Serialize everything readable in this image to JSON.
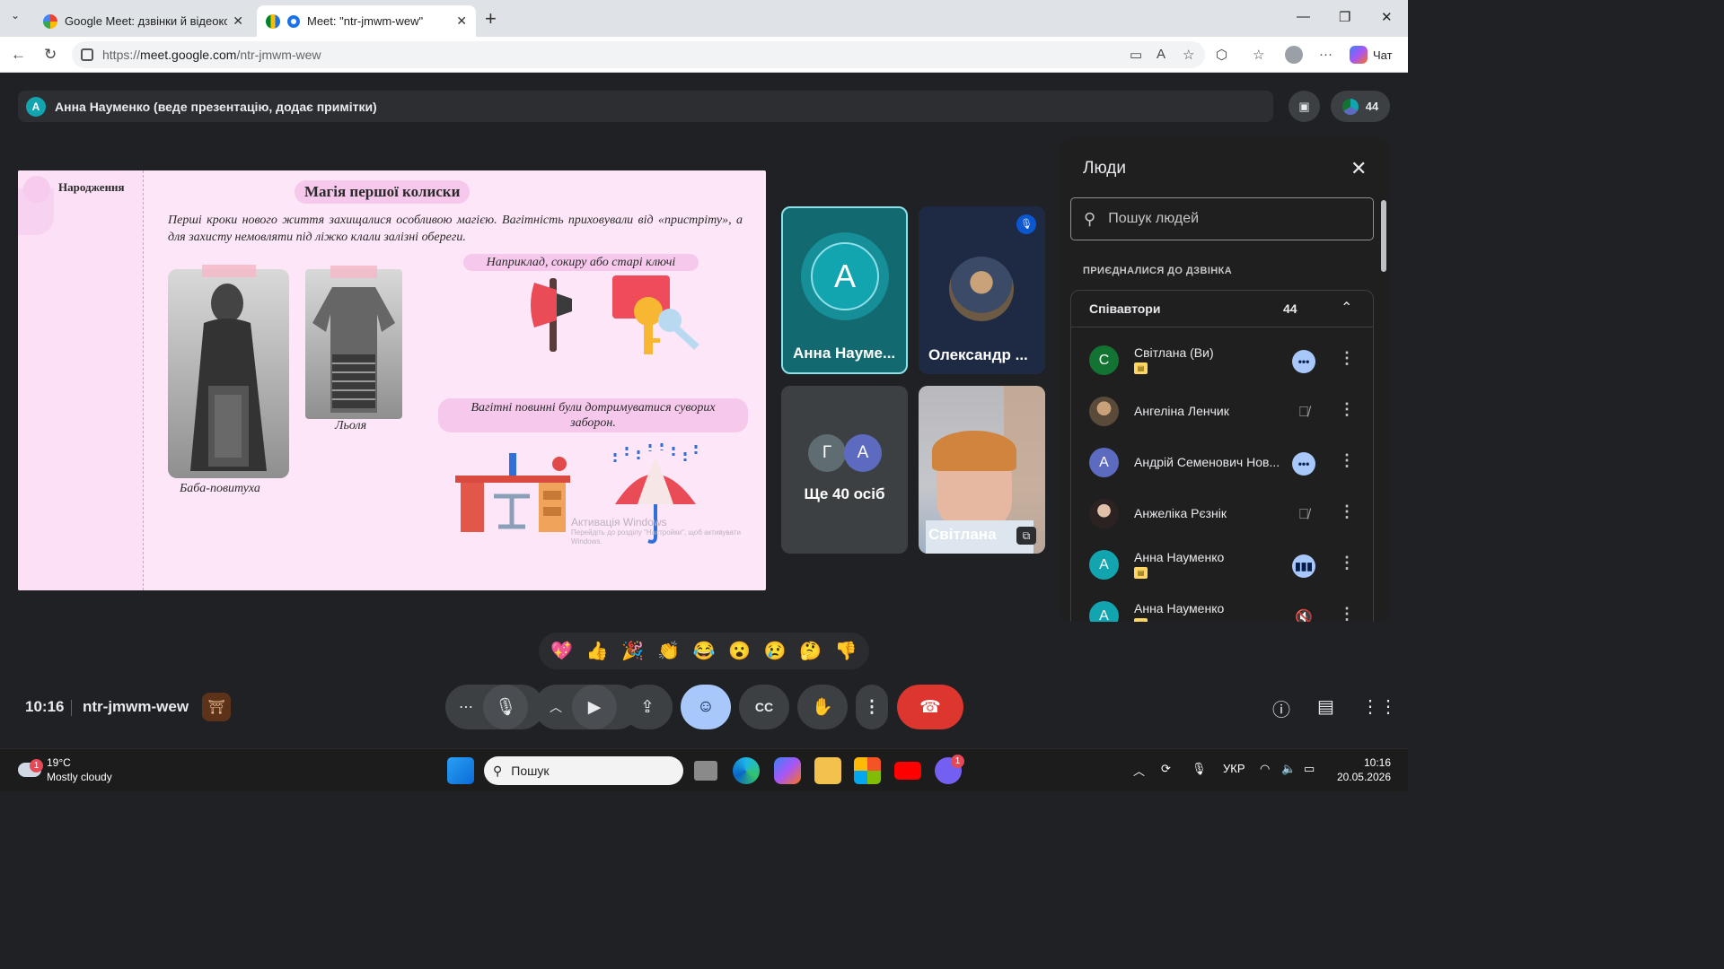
{
  "browser": {
    "tabs": [
      {
        "title": "Google Meet: дзвінки й відеоконференції",
        "active": false
      },
      {
        "title": "Meet: \"ntr-jmwm-wew\"",
        "active": true
      }
    ],
    "url_scheme": "https://",
    "url_host": "meet.google.com",
    "url_path": "/ntr-jmwm-wew",
    "chat_label": "Чат"
  },
  "meet": {
    "presenter_initial": "A",
    "presenter_text": "Анна Науменко (веде презентацію, додає примітки)",
    "participant_count": "44",
    "slide": {
      "section": "Народження",
      "title": "Магія першої колиски",
      "paragraph": "Перші кроки нового життя захищалися особливою магією. Вагітність приховували від «пристріту», а для захисту немовляти під ліжко клали залізні обереги.",
      "caption_left": "Баба-повитуха",
      "caption_right": "Льоля",
      "example_pill": "Наприклад, сокиру або старі ключі",
      "rules_pill": "Вагітні повинні були дотримуватися суворих заборон.",
      "watermark_title": "Активація Windows",
      "watermark_sub": "Перейдіть до розділу \"Настройки\", щоб активувати Windows."
    },
    "tiles": [
      {
        "name": "Анна Науме...",
        "initial": "A"
      },
      {
        "name": "Олександр ..."
      },
      {
        "name": "Ще 40 осіб",
        "initials": [
          "Г",
          "A"
        ]
      },
      {
        "name": "Світлана"
      }
    ],
    "people_panel": {
      "title": "Люди",
      "search_placeholder": "Пошук людей",
      "section_label": "ПРИЄДНАЛИСЯ ДО ДЗВІНКА",
      "group_name": "Співавтори",
      "group_count": "44",
      "participants": [
        {
          "name": "Світлана (Ви)",
          "initial": "С",
          "color": "#137333",
          "badge": true,
          "status": "dots"
        },
        {
          "name": "Ангеліна Ленчик",
          "initial": "",
          "color": "#6b5a3a",
          "badge": false,
          "status": "muted"
        },
        {
          "name": "Андрій Семенович Нов...",
          "initial": "A",
          "color": "#5c6bc0",
          "badge": false,
          "status": "dots"
        },
        {
          "name": "Анжеліка Рєзнік",
          "initial": "",
          "color": "#4a3b3b",
          "badge": false,
          "status": "muted"
        },
        {
          "name": "Анна Науменко",
          "initial": "A",
          "color": "#12a4af",
          "badge": true,
          "status": "speaking"
        },
        {
          "name": "Анна Науменко",
          "initial": "A",
          "color": "#12a4af",
          "badge": true,
          "status": "volume-off"
        }
      ]
    },
    "reactions": [
      "💖",
      "👍",
      "🎉",
      "👏",
      "😂",
      "😮",
      "😢",
      "🤔",
      "👎"
    ],
    "controls": {
      "time": "10:16",
      "meeting_code": "ntr-jmwm-wew"
    }
  },
  "taskbar": {
    "weather_temp": "19°C",
    "weather_desc": "Mostly cloudy",
    "weather_badge": "1",
    "search_placeholder": "Пошук",
    "language": "УКР",
    "time": "10:16",
    "date": "20.05.2026",
    "viber_badge": "1"
  }
}
